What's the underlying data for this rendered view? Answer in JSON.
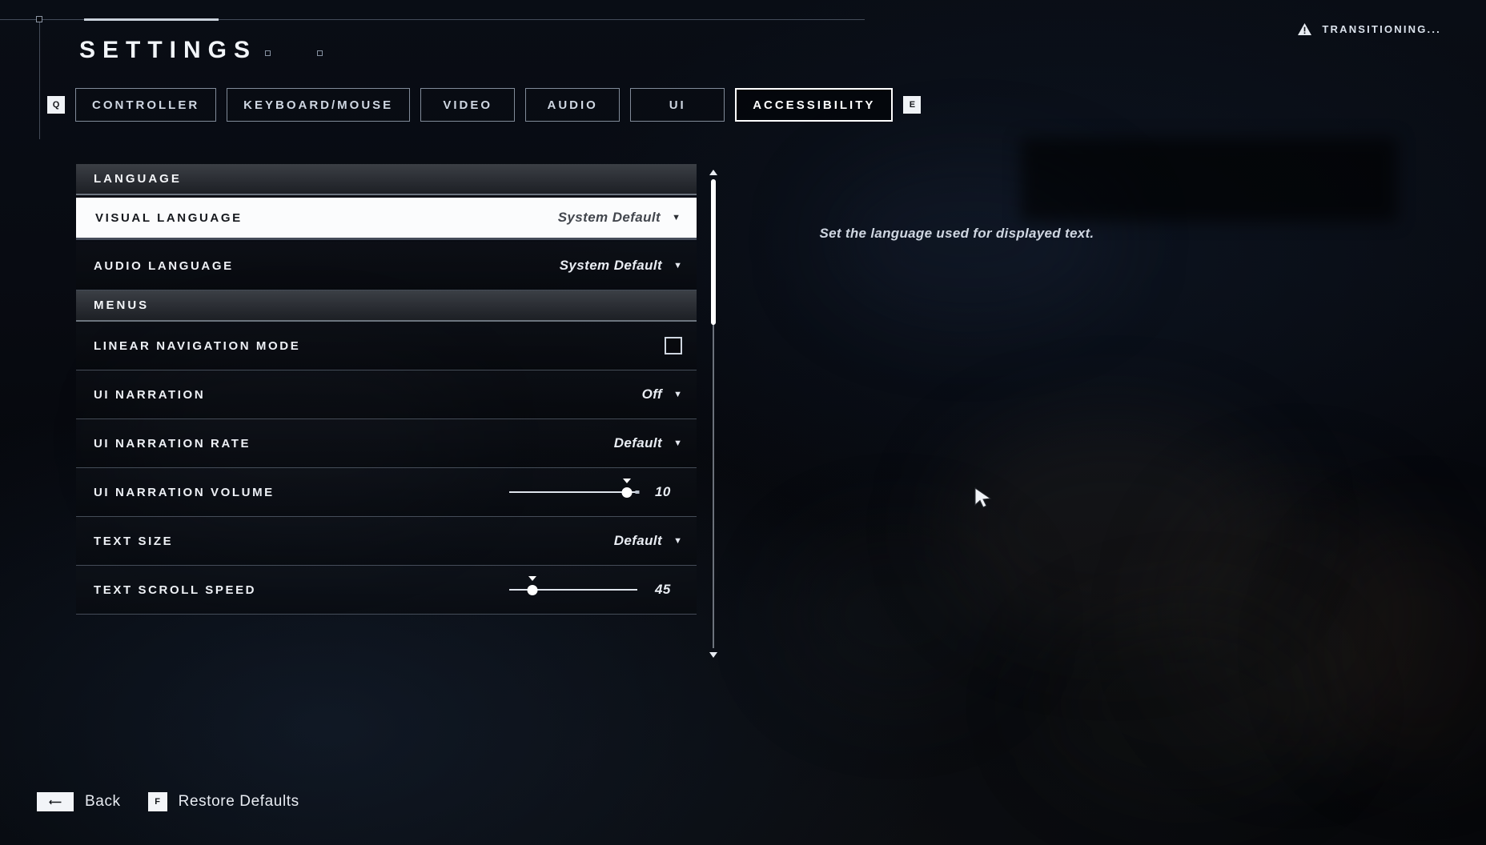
{
  "header": {
    "title": "SETTINGS",
    "status": {
      "icon": "warning-triangle-icon",
      "text": "TRANSITIONING..."
    },
    "prev_key": "Q",
    "next_key": "E"
  },
  "tabs": [
    {
      "label": "CONTROLLER",
      "active": false
    },
    {
      "label": "KEYBOARD/MOUSE",
      "active": false
    },
    {
      "label": "VIDEO",
      "active": false
    },
    {
      "label": "AUDIO",
      "active": false
    },
    {
      "label": "UI",
      "active": false
    },
    {
      "label": "ACCESSIBILITY",
      "active": true
    }
  ],
  "sections": [
    {
      "title": "LANGUAGE",
      "rows": [
        {
          "label": "VISUAL LANGUAGE",
          "type": "dropdown",
          "value": "System Default",
          "selected": true
        },
        {
          "label": "AUDIO LANGUAGE",
          "type": "dropdown",
          "value": "System Default",
          "selected": false
        }
      ]
    },
    {
      "title": "MENUS",
      "rows": [
        {
          "label": "LINEAR NAVIGATION MODE",
          "type": "checkbox",
          "value": "",
          "checked": false,
          "selected": false
        },
        {
          "label": "UI NARRATION",
          "type": "dropdown",
          "value": "Off",
          "selected": false
        },
        {
          "label": "UI NARRATION RATE",
          "type": "dropdown",
          "value": "Default",
          "selected": false
        },
        {
          "label": "UI NARRATION VOLUME",
          "type": "slider",
          "value": "10",
          "percent": 92,
          "selected": false
        },
        {
          "label": "TEXT SIZE",
          "type": "dropdown",
          "value": "Default",
          "selected": false
        },
        {
          "label": "TEXT SCROLL SPEED",
          "type": "slider",
          "value": "45",
          "percent": 18,
          "selected": false
        }
      ]
    }
  ],
  "description": "Set the language used for displayed text.",
  "scrollbar": {
    "thumb_top_percent": 0,
    "thumb_height_percent": 31
  },
  "footer": [
    {
      "key": "⟵",
      "label": "Back",
      "wide": true
    },
    {
      "key": "F",
      "label": "Restore Defaults",
      "wide": false
    }
  ],
  "colors": {
    "accent": "#ffffff",
    "panel_bg": "#0a0d13",
    "section_header": "#2a2d33",
    "text_primary": "#eef1f6",
    "selected_bg": "#fbfcfd"
  }
}
